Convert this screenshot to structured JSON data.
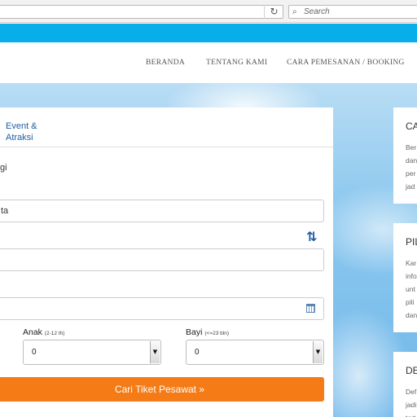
{
  "browser": {
    "reload_icon": "reload-icon",
    "search_placeholder": "Search"
  },
  "nav": {
    "items": [
      "BERANDA",
      "TENTANG KAMI",
      "CARA PEMESANAN / BOOKING"
    ]
  },
  "search": {
    "tab_event": "Event &\nAtraksi",
    "trip_fragment": "gi",
    "origin_value": "ta",
    "destination_value": "",
    "date_value": "",
    "passengers": {
      "anak_label": "Anak",
      "anak_hint": "(2-12 th)",
      "anak_value": "0",
      "bayi_label": "Bayi",
      "bayi_hint": "(<=23 bln)",
      "bayi_value": "0"
    },
    "submit_label": "Cari Tiket Pesawat »"
  },
  "cards": [
    {
      "title": "CA",
      "lines": [
        "Ber",
        "dan",
        "per",
        "jad"
      ]
    },
    {
      "title": "PIL",
      "lines": [
        "Kar",
        "info",
        "unt",
        "pili",
        "dan"
      ]
    },
    {
      "title": "DE",
      "lines": [
        "Def",
        "jadi",
        "tert"
      ]
    }
  ],
  "colors": {
    "brand_blue": "#07aeea",
    "accent_orange": "#f47b16",
    "link_blue": "#1f5da6"
  }
}
